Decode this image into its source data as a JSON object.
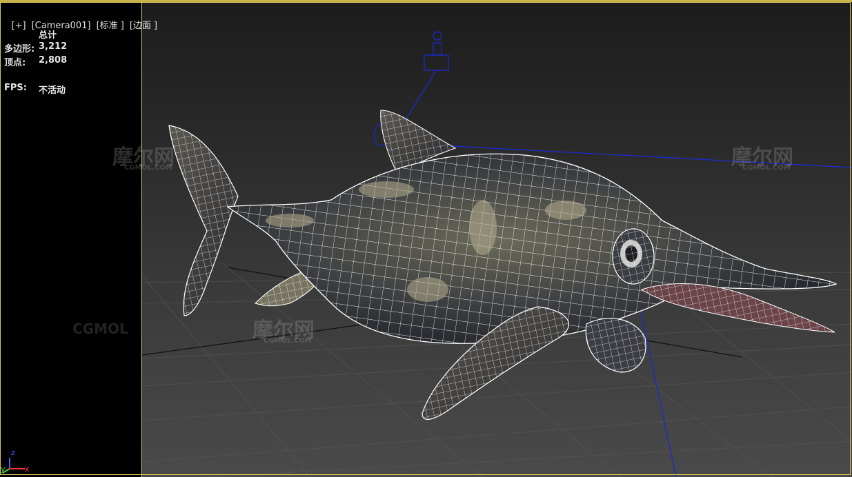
{
  "viewport": {
    "label_parts": [
      "[+]",
      "[Camera001]",
      "[标准 ]",
      "[边面 ]"
    ]
  },
  "stats": {
    "header": "总计",
    "polygons_label": "多边形:",
    "polygons_value": "3,212",
    "vertices_label": "顶点:",
    "vertices_value": "2,808",
    "fps_label": "FPS:",
    "fps_value": "不活动"
  },
  "watermarks": {
    "cn": "摩尔网",
    "en": "CGMOL.COM",
    "en_large": "CGMOL"
  },
  "axis_gizmo": {
    "z": "z",
    "y": "y",
    "x": "x"
  },
  "colors": {
    "viewport_border": "#d9c65a",
    "wireframe": "#ffffff",
    "camera_gizmo": "#1a2ad0",
    "axis_z": "#3f5fff",
    "axis_y": "#3fd03f",
    "axis_x": "#ff3030"
  }
}
